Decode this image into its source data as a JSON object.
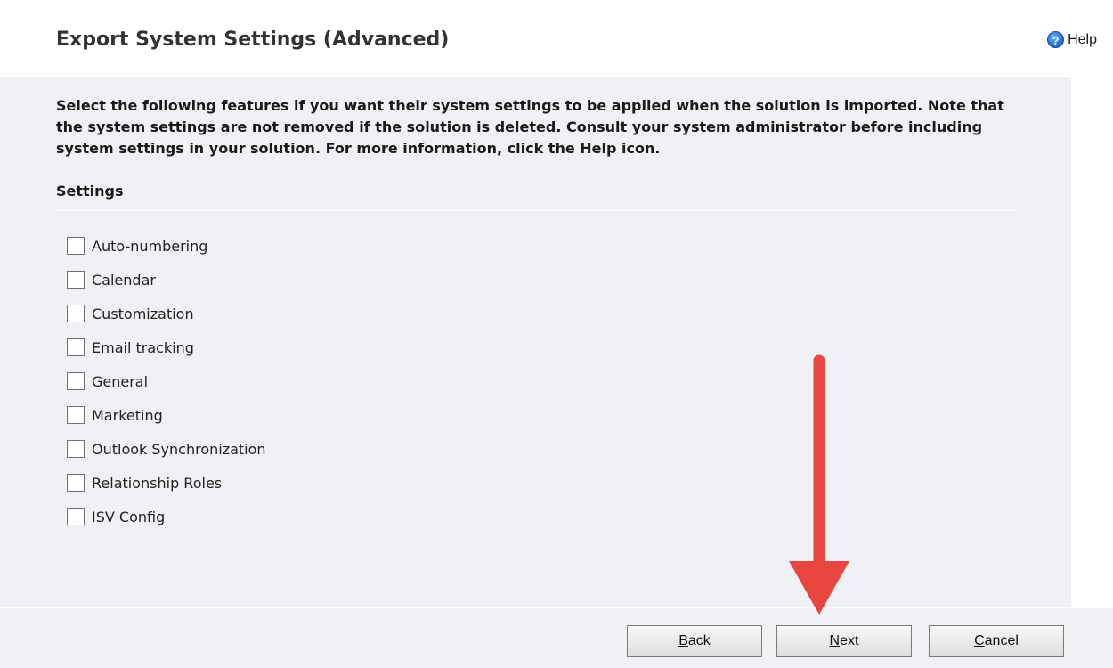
{
  "header": {
    "title": "Export System Settings (Advanced)",
    "help_icon": "help-icon",
    "help_label_first": "H",
    "help_label_rest": "elp"
  },
  "main": {
    "description": "Select the following features if you want their system settings to be applied when the solution is imported. Note that the system settings are not removed if the solution is deleted. Consult your system administrator before including system settings in your solution. For more information, click the Help icon.",
    "section_title": "Settings",
    "options": [
      {
        "label": "Auto-numbering",
        "checked": false
      },
      {
        "label": "Calendar",
        "checked": false
      },
      {
        "label": "Customization",
        "checked": false
      },
      {
        "label": "Email tracking",
        "checked": false
      },
      {
        "label": "General",
        "checked": false
      },
      {
        "label": "Marketing",
        "checked": false
      },
      {
        "label": "Outlook Synchronization",
        "checked": false
      },
      {
        "label": "Relationship Roles",
        "checked": false
      },
      {
        "label": "ISV Config",
        "checked": false
      }
    ]
  },
  "footer": {
    "back_first": "B",
    "back_rest": "ack",
    "next_first": "N",
    "next_rest": "ext",
    "cancel_first": "C",
    "cancel_rest": "ancel"
  },
  "colors": {
    "content_bg": "#f0f1f4",
    "annotation_arrow": "#e8463f"
  }
}
